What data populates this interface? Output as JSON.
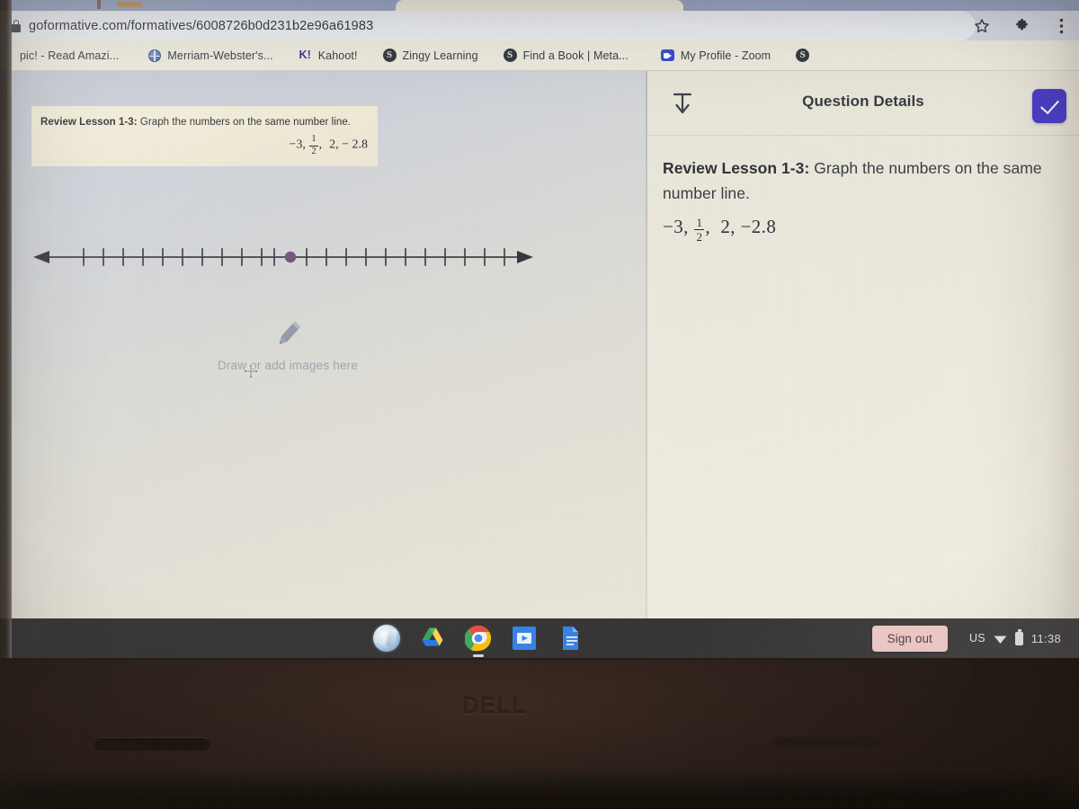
{
  "browser": {
    "url": "goformative.com/formatives/6008726b0d231b2e96a61983",
    "lock_icon": "lock-icon",
    "actions": {
      "bookmark_star": "★",
      "extensions": "🧩",
      "menu": "⋮"
    },
    "bookmarks": [
      {
        "label": "pic! - Read Amazi...",
        "icon": "favicon-partial"
      },
      {
        "label": "Merriam-Webster's...",
        "icon": "globe-favicon"
      },
      {
        "label": "Kahoot!",
        "icon": "kahoot-favicon"
      },
      {
        "label": "Zingy Learning",
        "icon": "sphere-favicon"
      },
      {
        "label": "Find a Book | Meta...",
        "icon": "sphere-favicon"
      },
      {
        "label": "My Profile - Zoom",
        "icon": "zoom-favicon"
      },
      {
        "label": "",
        "icon": "sphere-favicon"
      }
    ]
  },
  "canvas": {
    "question_card": {
      "prefix": "Review Lesson 1-3:",
      "body": " Graph the numbers on the same number line.",
      "math": {
        "first": "−3,",
        "fraction_num": "1",
        "fraction_den": "2",
        "rest": "2,  − 2.8"
      }
    },
    "number_line": {
      "tick_count_left": 12,
      "tick_count_right": 12,
      "plotted_point_label": "",
      "point_color": "#6b4d7a",
      "line_color": "#3a3540"
    },
    "placeholder": {
      "text": "Draw or add images here",
      "icon": "pencil-icon",
      "cursor": "move-cursor"
    }
  },
  "panel": {
    "header": {
      "title": "Question Details",
      "collapse_icon": "download-to-bar-icon",
      "submit_icon": "check-icon",
      "submit_color": "#3c2fc6"
    },
    "question": {
      "prefix": "Review Lesson 1-3:",
      "body": " Graph the numbers on the same number line.",
      "math": {
        "first": "−3,",
        "fraction_num": "1",
        "fraction_den": "2",
        "rest": "2,  −2.8"
      }
    }
  },
  "shelf": {
    "apps": [
      {
        "name": "launcher-icon",
        "label": "Launcher"
      },
      {
        "name": "google-drive-icon",
        "label": "Google Drive"
      },
      {
        "name": "chrome-icon",
        "label": "Google Chrome"
      },
      {
        "name": "google-slides-icon",
        "label": "Google Slides"
      },
      {
        "name": "google-docs-icon",
        "label": "Google Docs"
      }
    ],
    "sign_out_label": "Sign out",
    "keyboard_layout": "US",
    "time": "11:38",
    "wifi_icon": "wifi-icon",
    "battery_icon": "battery-icon"
  },
  "device": {
    "brand": "DELL"
  }
}
